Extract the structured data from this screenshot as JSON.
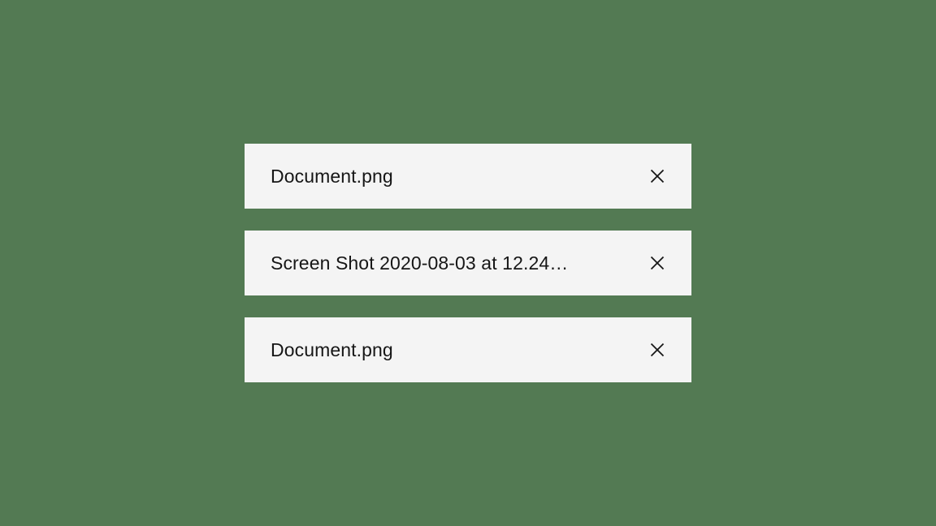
{
  "files": [
    {
      "name": "Document.png"
    },
    {
      "name": "Screen Shot 2020-08-03 at 12.24…"
    },
    {
      "name": "Document.png"
    }
  ]
}
